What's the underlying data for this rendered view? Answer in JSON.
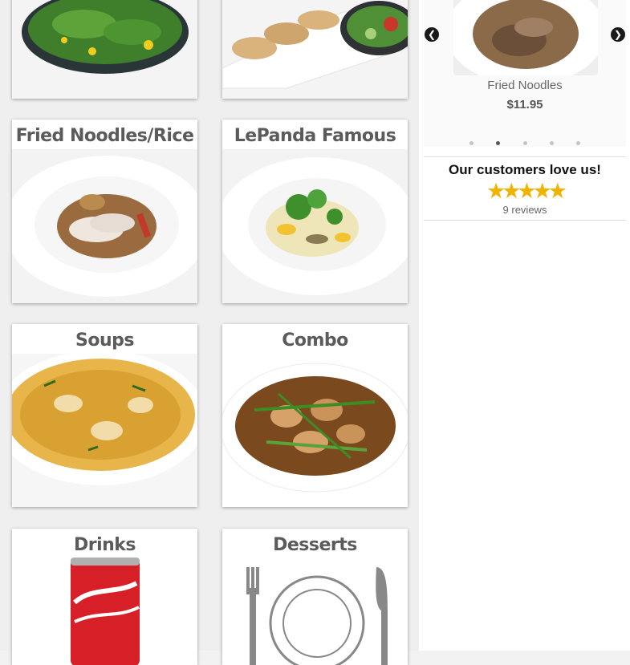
{
  "categories": [
    {
      "title": ""
    },
    {
      "title": ""
    },
    {
      "title": "Fried Noodles/Rice"
    },
    {
      "title": "LePanda Famous Wok"
    },
    {
      "title": "Soups"
    },
    {
      "title": "Combo"
    },
    {
      "title": "Drinks"
    },
    {
      "title": "Desserts"
    }
  ],
  "carousel": {
    "prev_icon": "chevron-left-icon",
    "next_icon": "chevron-right-icon",
    "item_name": "Fried Noodles",
    "item_price": "$11.95",
    "dot_count": 5,
    "active_dot": 2
  },
  "reviews": {
    "title": "Our customers love us!",
    "rating": 5,
    "count_text": "9 reviews",
    "star_color": "#f0b400"
  }
}
